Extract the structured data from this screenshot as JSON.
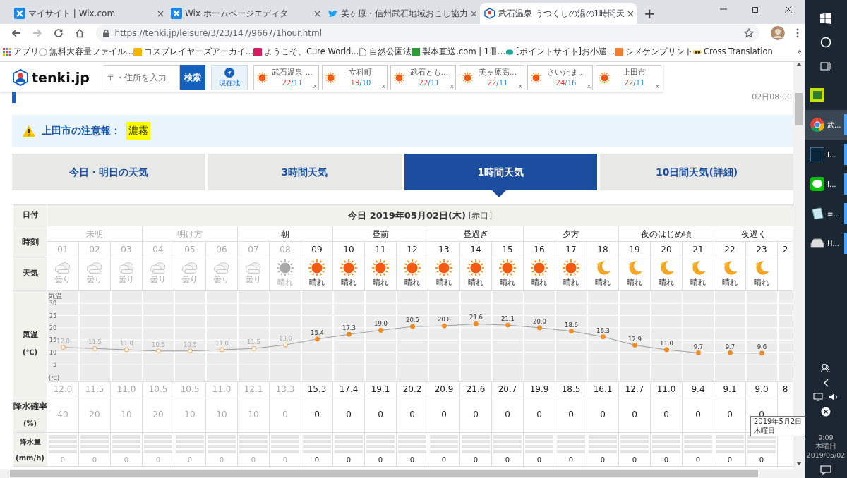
{
  "browser": {
    "tabs": [
      {
        "kind": "wix",
        "title": "マイサイト | Wix.com",
        "selected": false
      },
      {
        "kind": "wix",
        "title": "Wix ホームページエディタ",
        "selected": false
      },
      {
        "kind": "bird",
        "title": "美ヶ原・信州武石地域おこし協力",
        "selected": false
      },
      {
        "kind": "cube",
        "title": "武石温泉 うつくしの湯の1時間天",
        "selected": true
      }
    ],
    "new_tab": "+",
    "forward_disabled": true,
    "address": "https://tenki.jp/leisure/3/23/147/9667/1hour.html",
    "bookmarks": [
      {
        "kind": "apps",
        "label": "アプリ"
      },
      {
        "kind": "ring",
        "label": "無料大容量ファイル..."
      },
      {
        "kind": "yellow",
        "label": "コスプレイヤーズアーカイ..."
      },
      {
        "kind": "magenta",
        "label": "ようこそ、Cure World..."
      },
      {
        "kind": "page",
        "label": "自然公園法"
      },
      {
        "kind": "green",
        "label": "製本直送.com | 1冊..."
      },
      {
        "kind": "teal",
        "label": "[ポイントサイト]お小遣..."
      },
      {
        "kind": "orange",
        "label": "シメケンプリント"
      },
      {
        "kind": "glasses",
        "label": "Cross Translation"
      }
    ],
    "bookmarks_more": "»"
  },
  "site": {
    "logo": "tenki.jp",
    "search": {
      "placeholder": "〒・住所を入力",
      "button": "検索"
    },
    "location_button": "現在地",
    "favorites": [
      {
        "name": "武石温泉 ...",
        "high": "22",
        "low": "/11",
        "close": "x"
      },
      {
        "name": "立科町",
        "high": "19",
        "low": "/10",
        "close": "x"
      },
      {
        "name": "武石とも...",
        "high": "22",
        "low": "/11",
        "close": "x"
      },
      {
        "name": "美ヶ原高...",
        "high": "22",
        "low": "/11",
        "close": "x"
      },
      {
        "name": "さいたま...",
        "high": "24",
        "low": "/16",
        "close": "x"
      },
      {
        "name": "上田市",
        "high": "22",
        "low": "/11",
        "close": "x"
      }
    ]
  },
  "updated": "02日08:00",
  "alert": {
    "label": "上田市の注意報：",
    "warnings": [
      "濃霧"
    ]
  },
  "tabs": [
    {
      "label": "今日・明日の天気",
      "selected": false
    },
    {
      "label": "3時間天気",
      "selected": false
    },
    {
      "label": "1時間天気",
      "selected": true
    },
    {
      "label": "10日間天気(詳細)",
      "selected": false
    }
  ],
  "table": {
    "labels": {
      "date": "日付",
      "time": "時刻",
      "weather": "天気",
      "temp_unit": "(℃)",
      "prob": "降水確率",
      "prob_unit": "(%)",
      "amount": "降水量",
      "amount_unit": "(mm/h)",
      "chart_unit": "(℃)"
    },
    "date": "今日 2019年05月02日(木)",
    "rokuyo": "[赤口]",
    "periods": [
      {
        "label": "未明",
        "past": true
      },
      {
        "label": "明け方",
        "past": true
      },
      {
        "label": "朝",
        "past": false
      },
      {
        "label": "昼前",
        "past": false
      },
      {
        "label": "昼過ぎ",
        "past": false
      },
      {
        "label": "夕方",
        "past": false
      },
      {
        "label": "夜のはじめ頃",
        "past": false
      },
      {
        "label": "夜遅く",
        "past": false
      }
    ],
    "hours": [
      {
        "hour": "01",
        "past": true,
        "weather": {
          "kind": "cloudy",
          "label": "曇り"
        },
        "temp": "12.0",
        "prob": "40",
        "amount": "0"
      },
      {
        "hour": "02",
        "past": true,
        "weather": {
          "kind": "cloudy",
          "label": "曇り"
        },
        "temp": "11.5",
        "prob": "20",
        "amount": "0"
      },
      {
        "hour": "03",
        "past": true,
        "weather": {
          "kind": "cloudy",
          "label": "曇り"
        },
        "temp": "11.0",
        "prob": "10",
        "amount": "0"
      },
      {
        "hour": "04",
        "past": true,
        "weather": {
          "kind": "cloudy",
          "label": "曇り"
        },
        "temp": "10.5",
        "prob": "20",
        "amount": "0"
      },
      {
        "hour": "05",
        "past": true,
        "weather": {
          "kind": "cloudy",
          "label": "曇り"
        },
        "temp": "10.5",
        "prob": "10",
        "amount": "0"
      },
      {
        "hour": "06",
        "past": true,
        "weather": {
          "kind": "cloudy",
          "label": "曇り"
        },
        "temp": "11.0",
        "prob": "10",
        "amount": "0"
      },
      {
        "hour": "07",
        "past": true,
        "weather": {
          "kind": "cloudy",
          "label": "曇り"
        },
        "temp": "12.1",
        "prob": "10",
        "amount": "0"
      },
      {
        "hour": "08",
        "past": true,
        "weather": {
          "kind": "sunny",
          "label": "晴れ"
        },
        "temp": "13.3",
        "prob": "0",
        "amount": "0"
      },
      {
        "hour": "09",
        "past": false,
        "weather": {
          "kind": "sunny",
          "label": "晴れ"
        },
        "temp": "15.3",
        "prob": "0",
        "amount": "0"
      },
      {
        "hour": "10",
        "past": false,
        "weather": {
          "kind": "sunny",
          "label": "晴れ"
        },
        "temp": "17.4",
        "prob": "0",
        "amount": "0"
      },
      {
        "hour": "11",
        "past": false,
        "weather": {
          "kind": "sunny",
          "label": "晴れ"
        },
        "temp": "19.1",
        "prob": "0",
        "amount": "0"
      },
      {
        "hour": "12",
        "past": false,
        "weather": {
          "kind": "sunny",
          "label": "晴れ"
        },
        "temp": "20.2",
        "prob": "0",
        "amount": "0"
      },
      {
        "hour": "13",
        "past": false,
        "weather": {
          "kind": "sunny",
          "label": "晴れ"
        },
        "temp": "20.9",
        "prob": "0",
        "amount": "0"
      },
      {
        "hour": "14",
        "past": false,
        "weather": {
          "kind": "sunny",
          "label": "晴れ"
        },
        "temp": "21.6",
        "prob": "0",
        "amount": "0"
      },
      {
        "hour": "15",
        "past": false,
        "weather": {
          "kind": "sunny",
          "label": "晴れ"
        },
        "temp": "20.7",
        "prob": "0",
        "amount": "0"
      },
      {
        "hour": "16",
        "past": false,
        "weather": {
          "kind": "sunny",
          "label": "晴れ"
        },
        "temp": "19.9",
        "prob": "0",
        "amount": "0"
      },
      {
        "hour": "17",
        "past": false,
        "weather": {
          "kind": "sunny",
          "label": "晴れ"
        },
        "temp": "18.5",
        "prob": "0",
        "amount": "0"
      },
      {
        "hour": "18",
        "past": false,
        "weather": {
          "kind": "clear-night",
          "label": "晴れ"
        },
        "temp": "16.1",
        "prob": "0",
        "amount": "0"
      },
      {
        "hour": "19",
        "past": false,
        "weather": {
          "kind": "clear-night",
          "label": "晴れ"
        },
        "temp": "12.7",
        "prob": "0",
        "amount": "0"
      },
      {
        "hour": "20",
        "past": false,
        "weather": {
          "kind": "clear-night",
          "label": "晴れ"
        },
        "temp": "11.0",
        "prob": "0",
        "amount": "0"
      },
      {
        "hour": "21",
        "past": false,
        "weather": {
          "kind": "clear-night",
          "label": "晴れ"
        },
        "temp": "9.4",
        "prob": "0",
        "amount": "0"
      },
      {
        "hour": "22",
        "past": false,
        "weather": {
          "kind": "clear-night",
          "label": "晴れ"
        },
        "temp": "9.1",
        "prob": "0",
        "amount": "0"
      },
      {
        "hour": "23",
        "past": false,
        "weather": {
          "kind": "clear-night",
          "label": "晴れ"
        },
        "temp": "9.0",
        "prob": "0",
        "amount": "0"
      },
      {
        "hour": "2",
        "past": false,
        "temp": "8"
      }
    ],
    "chart_data": {
      "type": "line",
      "ylabel": "気温",
      "series": [
        {
          "name": "気温",
          "color": "#f08a24",
          "marker": "circle",
          "values": [
            12.0,
            11.5,
            11.0,
            10.5,
            10.5,
            11.0,
            11.5,
            13.0,
            15.4,
            17.3,
            19.0,
            20.5,
            20.8,
            21.6,
            21.1,
            20.0,
            18.6,
            16.3,
            12.9,
            11.0,
            9.7,
            9.7,
            9.6
          ]
        }
      ],
      "value_labels": [
        "12.0",
        "11.5",
        "11.0",
        "10.5",
        "10.5",
        "11.0",
        "11.5",
        "13.0",
        "15.4",
        "17.3",
        "19.0",
        "20.5",
        "20.8",
        "21.6",
        "21.1",
        "20.0",
        "18.6",
        "16.3",
        "12.9",
        "11.0",
        "9.7",
        "9.7",
        "9.6"
      ],
      "ylim": [
        -2,
        35
      ],
      "yticks": [
        5,
        10,
        15,
        20,
        25,
        30
      ],
      "grid": true
    }
  },
  "tooltip": [
    "2019年5月2日",
    "木曜日"
  ],
  "taskbar": {
    "items": [
      {
        "kind": "green-app",
        "running": false,
        "selected": false
      },
      {
        "kind": "chrome",
        "label": "武...",
        "running": true,
        "selected": true
      },
      {
        "kind": "lr",
        "label": "I...",
        "running": true,
        "selected": false
      },
      {
        "kind": "line",
        "label": "I...",
        "running": true,
        "selected": false
      },
      {
        "kind": "notes",
        "label": "≡...",
        "running": true,
        "selected": false
      },
      {
        "kind": "drive",
        "label": "H...",
        "running": true,
        "selected": false
      }
    ],
    "time": "9:09",
    "weekday": "木曜日",
    "date": "2019/05/02"
  }
}
